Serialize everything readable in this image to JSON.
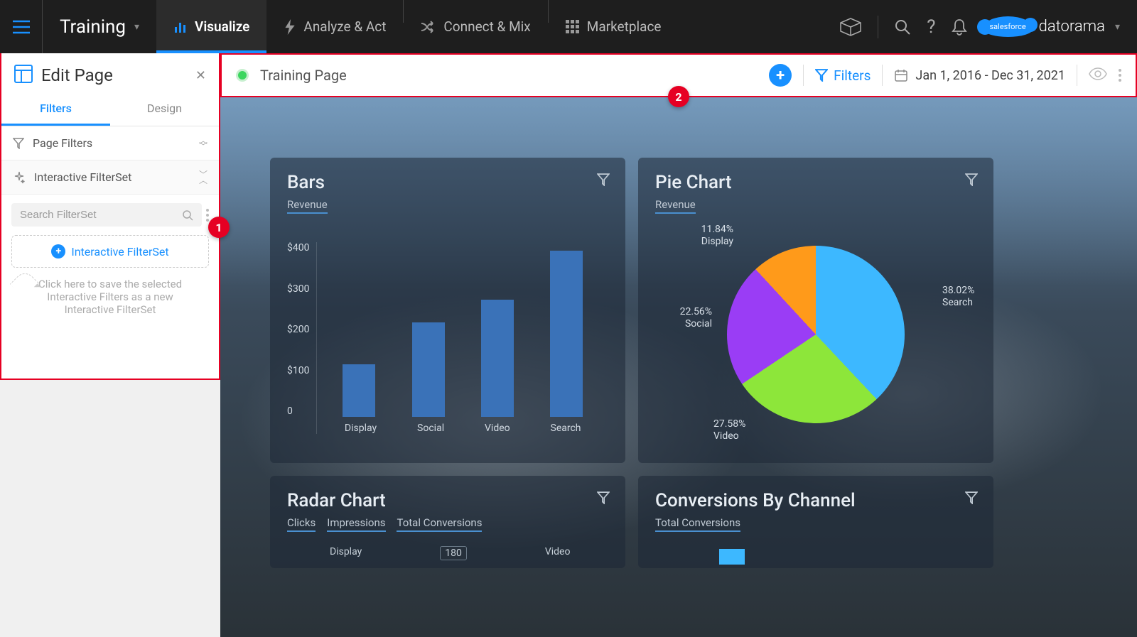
{
  "nav": {
    "workspace": "Training",
    "tabs": {
      "visualize": "Visualize",
      "analyze": "Analyze & Act",
      "connect": "Connect & Mix",
      "marketplace": "Marketplace"
    },
    "brand_sf": "salesforce",
    "brand_dr": "datorama"
  },
  "sidebar": {
    "title": "Edit Page",
    "tabs": {
      "filters": "Filters",
      "design": "Design"
    },
    "page_filters": "Page Filters",
    "interactive_filterset": "Interactive FilterSet",
    "search_placeholder": "Search FilterSet",
    "add_filterset": "Interactive FilterSet",
    "hint": "Click here to save the selected Interactive Filters as a new Interactive FilterSet"
  },
  "toolbar": {
    "page_name": "Training Page",
    "filters": "Filters",
    "date_range": "Jan 1, 2016 - Dec 31, 2021"
  },
  "callouts": {
    "one": "1",
    "two": "2"
  },
  "widgets": {
    "bars": {
      "title": "Bars",
      "sub": "Revenue"
    },
    "pie": {
      "title": "Pie Chart",
      "sub": "Revenue"
    },
    "radar": {
      "title": "Radar Chart",
      "m1": "Clicks",
      "m2": "Impressions",
      "m3": "Total Conversions",
      "cat1": "Display",
      "cat2": "Video",
      "val": "180"
    },
    "conv": {
      "title": "Conversions By Channel",
      "sub": "Total Conversions"
    }
  },
  "chart_data": [
    {
      "id": "bars",
      "type": "bar",
      "title": "Bars",
      "ylabel": "Revenue",
      "categories": [
        "Display",
        "Social",
        "Video",
        "Search"
      ],
      "values": [
        135,
        245,
        300,
        430
      ],
      "yticks": [
        "$400",
        "$300",
        "$200",
        "$100",
        "0"
      ],
      "ylim": [
        0,
        450
      ]
    },
    {
      "id": "pie",
      "type": "pie",
      "title": "Pie Chart",
      "series": [
        {
          "name": "Search",
          "value": 38.02,
          "color": "#3db8ff"
        },
        {
          "name": "Social",
          "value": 27.58,
          "color": "#8de63a"
        },
        {
          "name": "Display",
          "value": 22.56,
          "color": "#9a3df5"
        },
        {
          "name": "Video",
          "value": 11.84,
          "color": "#ff9a1a"
        }
      ],
      "labels": {
        "search": "38.02%\nSearch",
        "social": "27.58%\nSocial",
        "display": "11.84%\nDisplay",
        "video": "22.56%\nSocial",
        "l_display": "11.84%",
        "l_display2": "Display",
        "l_social": "22.56%",
        "l_social2": "Social",
        "l_search": "38.02%",
        "l_search2": "Search",
        "l_green": "27.58%",
        "l_green2": "Video"
      }
    }
  ]
}
